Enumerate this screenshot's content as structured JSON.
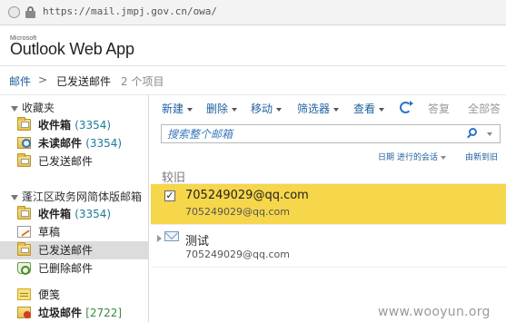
{
  "browser": {
    "url": "https://mail.jmpj.gov.cn/owa/"
  },
  "app": {
    "logo_small": "Microsoft",
    "logo_main": "Outlook Web App"
  },
  "breadcrumb": {
    "root": "邮件",
    "separator": ">",
    "current": "已发送邮件",
    "count": "2 个项目"
  },
  "nav": {
    "favorites_header": "收藏夹",
    "favorites": [
      {
        "label": "收件箱",
        "count": "(3354)",
        "icon": "inbox-icon"
      },
      {
        "label": "未读邮件",
        "count": "(3354)",
        "icon": "search-folder-icon"
      },
      {
        "label": "已发送邮件",
        "count": "",
        "icon": "sent-folder-icon"
      }
    ],
    "mailbox_header": "蓬江区政务网简体版邮箱",
    "mailbox": [
      {
        "label": "收件箱",
        "count": "(3354)",
        "icon": "inbox-icon"
      },
      {
        "label": "草稿",
        "count": "",
        "icon": "drafts-icon"
      },
      {
        "label": "已发送邮件",
        "count": "",
        "icon": "sent-folder-icon"
      },
      {
        "label": "已删除邮件",
        "count": "",
        "icon": "deleted-items-icon"
      },
      {
        "label": "便笺",
        "count": "",
        "icon": "notes-icon"
      },
      {
        "label": "垃圾邮件",
        "count": "[2722]",
        "icon": "junk-folder-icon"
      }
    ]
  },
  "toolbar": {
    "new": "新建",
    "delete": "删除",
    "move": "移动",
    "filter": "筛选器",
    "view": "查看",
    "reply": "答复",
    "reply_all": "全部答"
  },
  "search": {
    "placeholder": "搜索整个邮箱"
  },
  "sort": {
    "by_date": "日期",
    "conversation": "进行的会话",
    "order": "由新到旧"
  },
  "list": {
    "group_label": "较旧",
    "messages": [
      {
        "from": "705249029@qq.com",
        "subject": "705249029@qq.com",
        "selected": true
      },
      {
        "from": "测试",
        "subject": "705249029@qq.com",
        "selected": false
      }
    ]
  },
  "watermark": "www.wooyun.org",
  "colors": {
    "accent": "#1f5f9f",
    "selected_row": "#f6d64a",
    "nav_selected": "#dcdcdc"
  }
}
